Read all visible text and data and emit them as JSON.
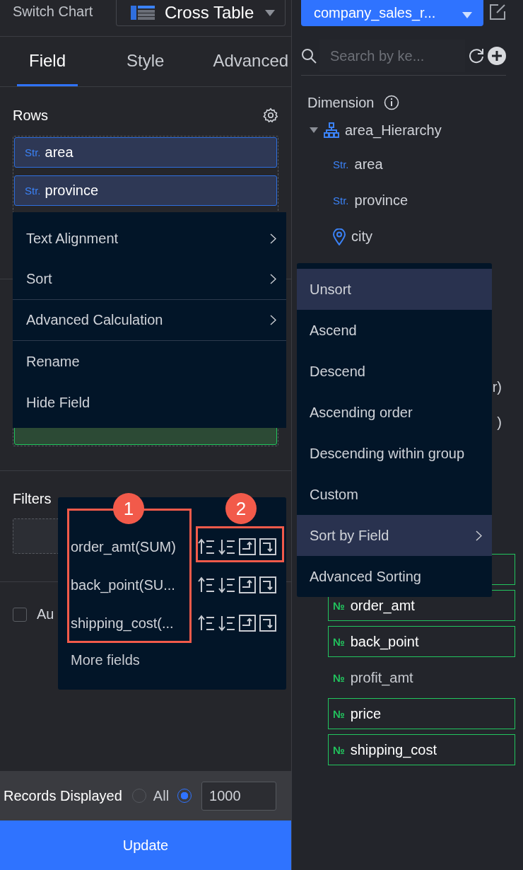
{
  "header": {
    "label": "Switch Chart",
    "chart_type": "Cross Table"
  },
  "tabs": [
    {
      "label": "Field",
      "selected": true
    },
    {
      "label": "Style",
      "selected": false
    },
    {
      "label": "Advanced",
      "selected": false
    }
  ],
  "rows_section": {
    "title": "Rows",
    "fields": [
      {
        "type": "Str.",
        "name": "area"
      },
      {
        "type": "Str.",
        "name": "province"
      }
    ]
  },
  "filters_section": {
    "title": "Filters"
  },
  "auto_option": {
    "label": "Au",
    "checked": false
  },
  "records_bar": {
    "label": "Records Displayed",
    "options": [
      {
        "kind": "radio",
        "label": "All",
        "selected": false
      },
      {
        "kind": "input",
        "value": "1000",
        "selected": true
      }
    ]
  },
  "update_button": "Update",
  "context_menu": [
    {
      "label": "Text Alignment",
      "submenu": true,
      "divider_after": false
    },
    {
      "label": "Sort",
      "submenu": true,
      "divider_after": true
    },
    {
      "label": "Advanced Calculation",
      "submenu": true,
      "divider_after": true
    },
    {
      "label": "Rename",
      "submenu": false,
      "divider_after": false
    },
    {
      "label": "Hide Field",
      "submenu": false,
      "divider_after": false
    }
  ],
  "sort_field_popup": {
    "rows": [
      {
        "field": "order_amt(SUM)"
      },
      {
        "field": "back_point(SU..."
      },
      {
        "field": "shipping_cost(..."
      }
    ],
    "more": "More fields"
  },
  "annotations": [
    {
      "label": "1"
    },
    {
      "label": "2"
    }
  ],
  "dataset": {
    "name": "company_sales_r..."
  },
  "search": {
    "placeholder": "Search by ke..."
  },
  "dimension": {
    "title": "Dimension",
    "tree": [
      {
        "kind": "hierarchy",
        "label": "area_Hierarchy",
        "expanded": true,
        "children": [
          {
            "kind": "string",
            "type": "Str.",
            "label": "area"
          },
          {
            "kind": "string",
            "type": "Str.",
            "label": "province"
          },
          {
            "kind": "geo",
            "label": "city"
          }
        ]
      }
    ],
    "partial_items": [
      "r)",
      ")"
    ]
  },
  "measures": [
    {
      "in_use": true
    },
    {
      "type": "№",
      "label": "order_amt",
      "in_use": true
    },
    {
      "type": "№",
      "label": "back_point",
      "in_use": true
    },
    {
      "type": "№",
      "label": "profit_amt",
      "in_use": false
    },
    {
      "type": "№",
      "label": "price",
      "in_use": true
    },
    {
      "type": "№",
      "label": "shipping_cost",
      "in_use": true
    }
  ],
  "sort_menu": [
    {
      "label": "Unsort",
      "highlighted": true,
      "submenu": false
    },
    {
      "label": "Ascend",
      "highlighted": false,
      "submenu": false
    },
    {
      "label": "Descend",
      "highlighted": false,
      "submenu": false
    },
    {
      "label": "Ascending order",
      "highlighted": false,
      "submenu": false
    },
    {
      "label": "Descending within group",
      "highlighted": false,
      "submenu": false
    },
    {
      "label": "Custom",
      "highlighted": false,
      "submenu": false
    },
    {
      "label": "Sort by Field",
      "highlighted": true,
      "submenu": true
    },
    {
      "label": "Advanced Sorting",
      "highlighted": false,
      "submenu": false
    }
  ]
}
